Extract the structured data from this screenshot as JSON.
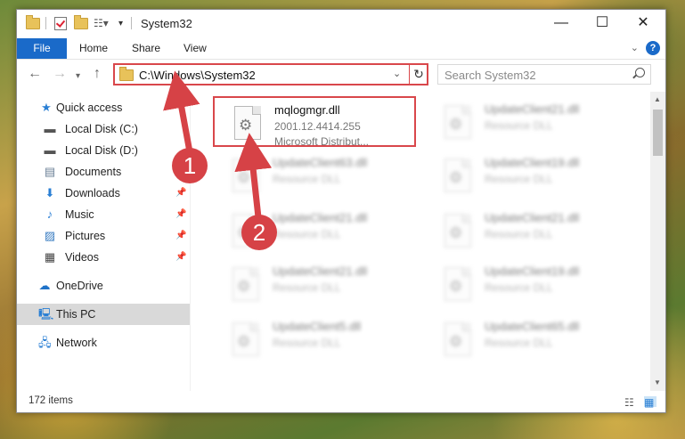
{
  "window": {
    "title": "System32",
    "controls": {
      "minimize": "—",
      "maximize": "☐",
      "close": "✕"
    }
  },
  "ribbon": {
    "tabs": [
      "File",
      "Home",
      "Share",
      "View"
    ],
    "help": "?"
  },
  "nav": {
    "address": "C:\\Windows\\System32",
    "search_placeholder": "Search System32"
  },
  "sidebar": {
    "items": [
      {
        "label": "Quick access",
        "icon": "star-icon",
        "pinned": false
      },
      {
        "label": "Local Disk (C:)",
        "icon": "drive-icon",
        "pinned": false
      },
      {
        "label": "Local Disk (D:)",
        "icon": "drive-icon",
        "pinned": false
      },
      {
        "label": "Documents",
        "icon": "documents-icon",
        "pinned": false
      },
      {
        "label": "Downloads",
        "icon": "downloads-icon",
        "pinned": true
      },
      {
        "label": "Music",
        "icon": "music-icon",
        "pinned": true
      },
      {
        "label": "Pictures",
        "icon": "pictures-icon",
        "pinned": true
      },
      {
        "label": "Videos",
        "icon": "videos-icon",
        "pinned": true
      },
      {
        "label": "OneDrive",
        "icon": "onedrive-icon",
        "pinned": false
      },
      {
        "label": "This PC",
        "icon": "this-pc-icon",
        "pinned": false,
        "selected": true
      },
      {
        "label": "Network",
        "icon": "network-icon",
        "pinned": false
      }
    ]
  },
  "files": [
    {
      "name": "mqlogmgr.dll",
      "line2": "2001.12.4414.255",
      "line3": "Microsoft Distribut..."
    },
    {
      "name": "UpdateClient21.dll",
      "line2": "Resource DLL"
    },
    {
      "name": "UpdateClient63.dll",
      "line2": "Resource DLL"
    },
    {
      "name": "UpdateClient19.dll",
      "line2": "Resource DLL"
    },
    {
      "name": "UpdateClient21.dll",
      "line2": "Resource DLL"
    },
    {
      "name": "UpdateClient21.dll",
      "line2": "Resource DLL"
    },
    {
      "name": "UpdateClient21.dll",
      "line2": "Resource DLL"
    },
    {
      "name": "UpdateClient19.dll",
      "line2": "Resource DLL"
    },
    {
      "name": "UpdateClient5.dll",
      "line2": "Resource DLL"
    },
    {
      "name": "UpdateClient65.dll",
      "line2": "Resource DLL"
    }
  ],
  "status": {
    "item_count": "172 items"
  },
  "annotations": {
    "step1": "1",
    "step2": "2"
  },
  "colors": {
    "accent": "#1a6ac9",
    "highlight": "#d9474b",
    "selected_bg": "#d9d9d9"
  }
}
